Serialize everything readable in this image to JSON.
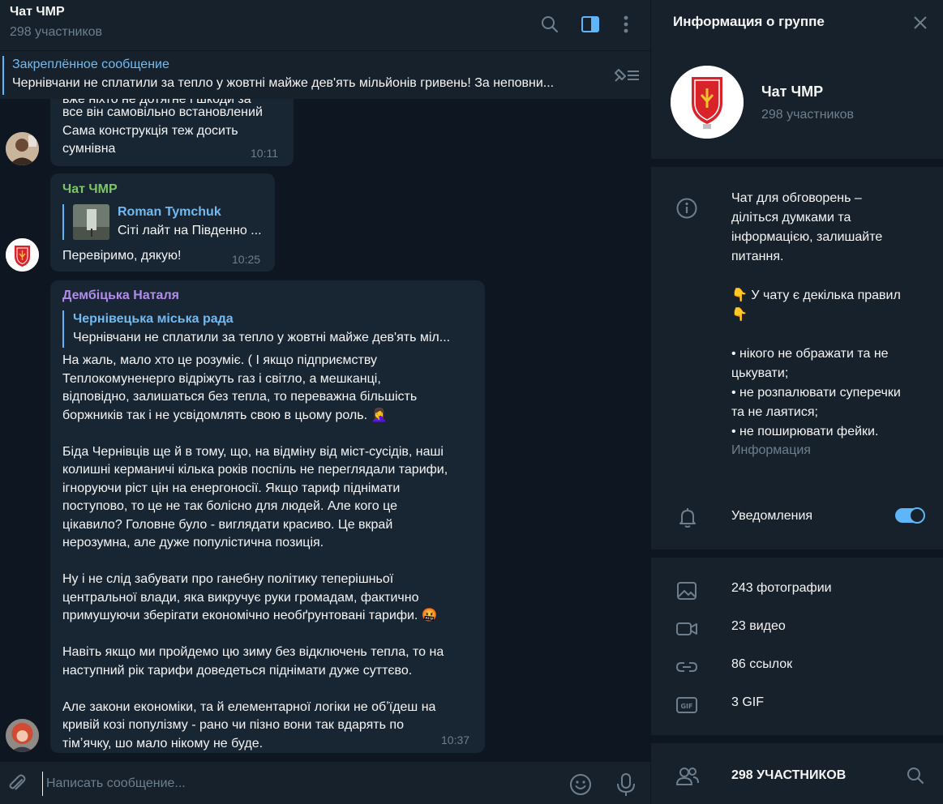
{
  "chat": {
    "title": "Чат ЧМР",
    "subtitle": "298 участников",
    "pinned": {
      "title": "Закреплённое сообщение",
      "text": "Чернівчани не сплатили за тепло у жовтні майже дев'ять мільйонів гривень!  За неповни..."
    },
    "messages": [
      {
        "text_top_cut": "вже ніхто не дотягне і шкоди за",
        "text": "все він самовільно встановлений\nСама конструкція теж досить\nсумнівна",
        "time": "10:11"
      },
      {
        "sender": "Чат ЧМР",
        "reply_name": "Roman Tymchuk",
        "reply_text": "Сіті лайт на Південно ...",
        "text": "Перевіримо, дякую!",
        "time": "10:25"
      },
      {
        "sender": "Дембіцька Наталя",
        "reply_name": "Чернівецька міська рада",
        "reply_text": "Чернівчани не сплатили за тепло у жовтні майже дев'ять міл...",
        "text": "На жаль, мало хто це розуміє. (  І якщо підприємству\nТеплокомуненерго відріжуть газ і світло, а мешканці,\nвідповідно, залишаться без тепла, то переважна більшість\nборжників так і не усвідомлять свою в цьому роль. 🤦‍♀️\n\nБіда Чернівців ще й в тому, що, на відміну від міст-сусідів, наші\nколишні керманичі кілька років поспіль не переглядали тарифи,\nігноруючи ріст цін на енергоносії.  Якщо тариф піднімати\nпоступово, то це не так болісно для людей.  Але кого це\nцікавило?  Головне було - виглядати красиво.  Це вкрай\nнерозумна, але дуже популістична позиція.\n\nНу і не слід забувати про ганебну політику теперішньої\nцентральної влади, яка викручує руки громадам, фактично\nпримушуючи зберігати економічно необґрунтовані тарифи. 🤬\n\nНавіть якщо ми пройдемо цю зиму без відключень тепла, то на\nнаступний рік тарифи доведеться піднімати дуже суттєво.\n\nАле закони економіки, та й елементарної логіки не обʼїдеш на\nкривій козі популізму - рано чи пізно вони так вдарять по\nтімʼячку, шо мало нікому не буде.",
        "time": "10:37"
      }
    ],
    "composer_placeholder": "Написать сообщение..."
  },
  "info": {
    "title": "Информация о группе",
    "group_name": "Чат ЧМР",
    "group_members": "298 участников",
    "about": "Чат для обговорень –\nділіться думками та\nінформацією, залишайте\nпитання.\n\n👇 У чату є декілька правил\n👇\n\n• нікого не ображати та не\nцькувати;\n• не розпалювати суперечки\nта не лаятися;\n• не поширювати фейки.",
    "about_caption": "Информация",
    "notifications_label": "Уведомления",
    "notifications_on": true,
    "media": [
      {
        "icon": "photo-icon",
        "label": "243 фотографии"
      },
      {
        "icon": "video-icon",
        "label": "23 видео"
      },
      {
        "icon": "link-icon",
        "label": "86 ссылок"
      },
      {
        "icon": "gif-icon",
        "label": "3 GIF"
      }
    ],
    "members_label": "298 УЧАСТНИКОВ"
  },
  "colors": {
    "bg": "#0e1621",
    "panel": "#17212b",
    "bubble": "#182533",
    "accent": "#5eb5f7",
    "muted": "#6d7f8f",
    "sender_green": "#7bc862",
    "sender_purple": "#b28ce8"
  }
}
